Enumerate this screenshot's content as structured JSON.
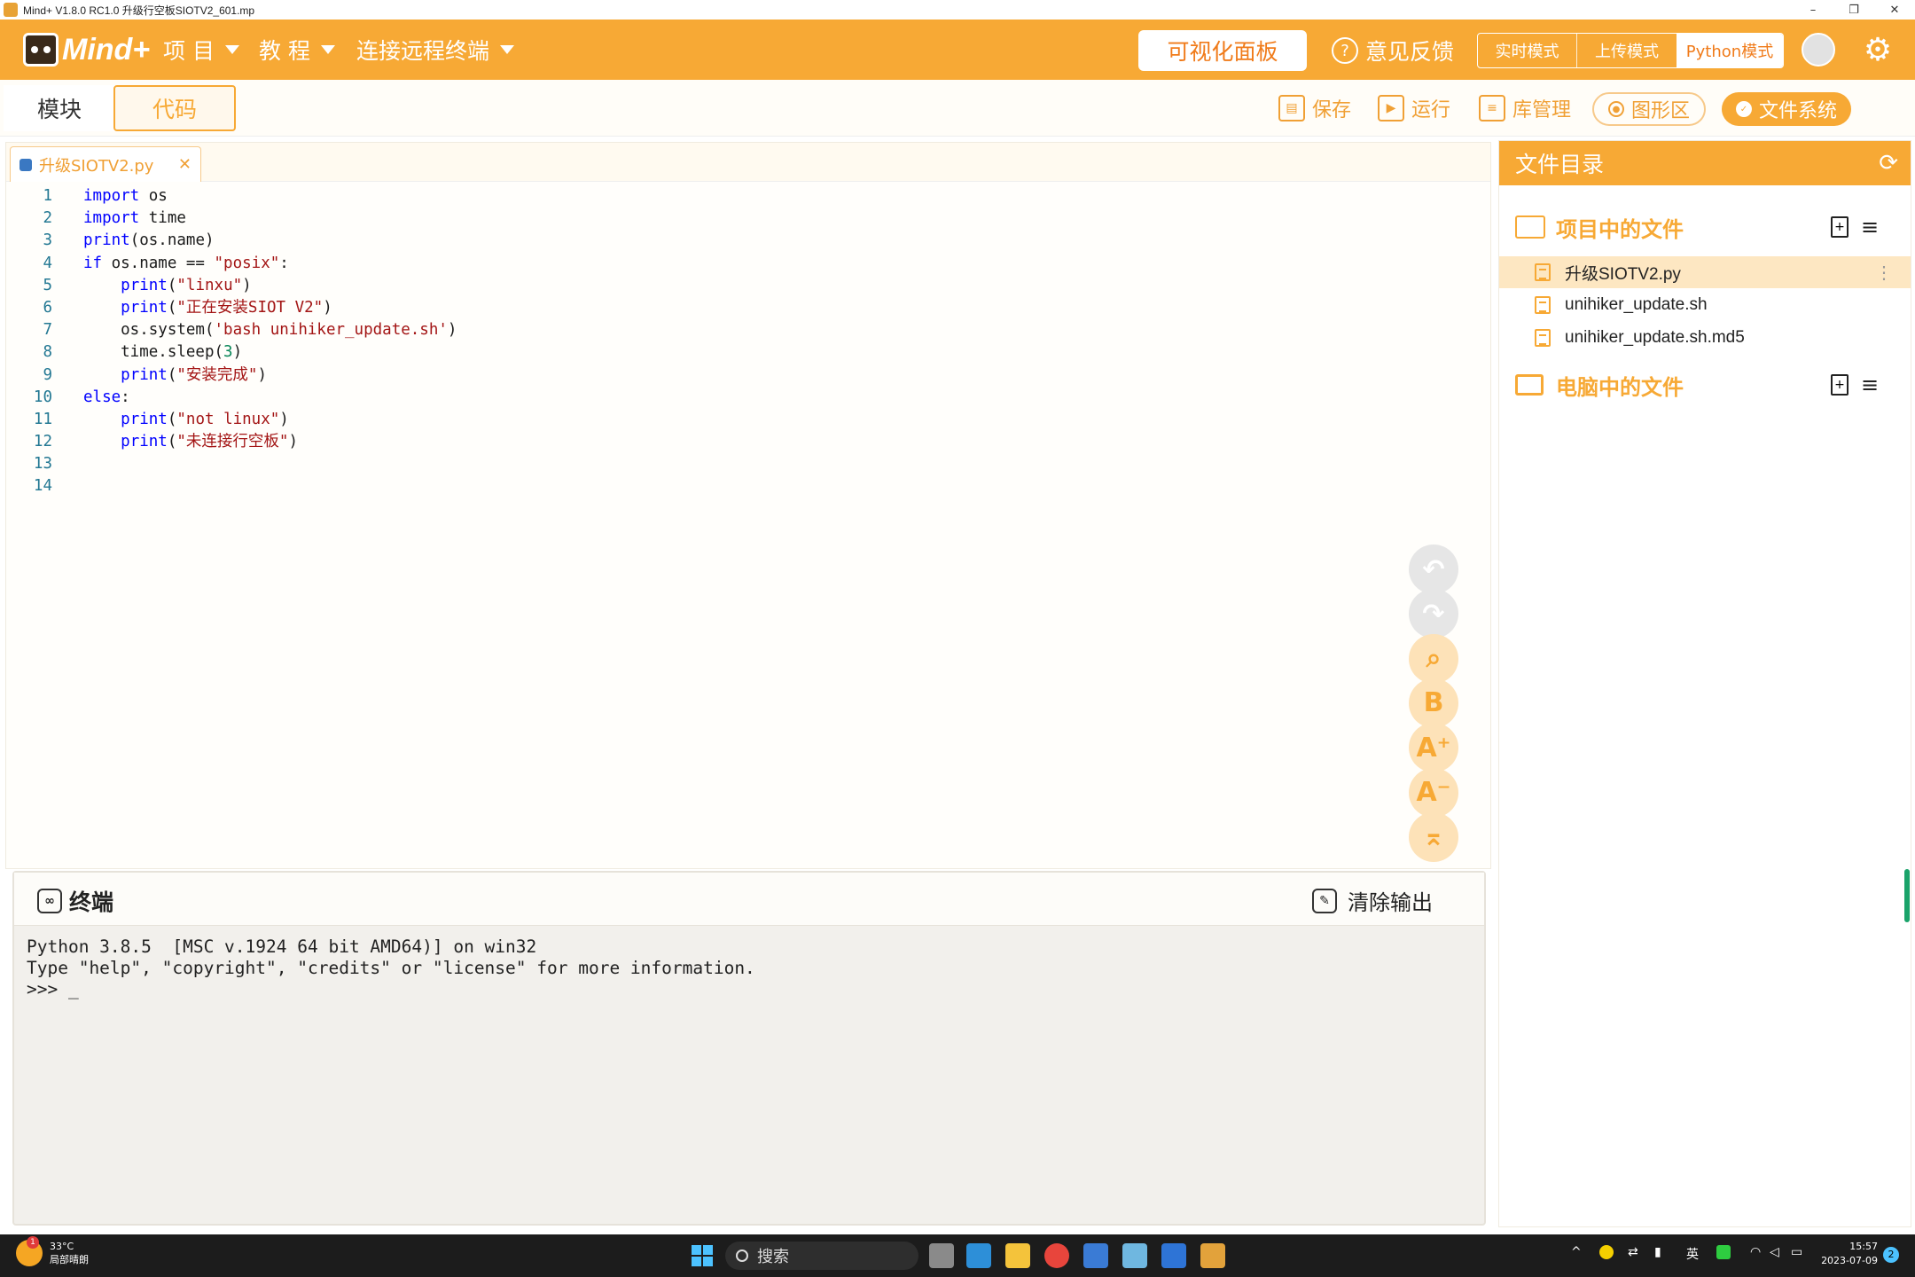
{
  "window": {
    "title": "Mind+ V1.8.0 RC1.0   升级行空板SIOTV2_601.mp",
    "minimize": "–",
    "maximize": "❐",
    "close": "✕"
  },
  "topbar": {
    "logo_text": "Mind+",
    "menu": [
      {
        "label": "项 目"
      },
      {
        "label": "教 程"
      },
      {
        "label": "连接远程终端"
      }
    ],
    "visual_panel": "可视化面板",
    "feedback": "意见反馈",
    "modes": [
      {
        "label": "实时模式",
        "active": false
      },
      {
        "label": "上传模式",
        "active": false
      },
      {
        "label": "Python模式",
        "active": true
      }
    ]
  },
  "toolbar": {
    "tab_blocks": "模块",
    "tab_code": "代码",
    "save": "保存",
    "run": "运行",
    "lib_manage": "库管理",
    "graphics": "图形区",
    "file_system": "文件系统"
  },
  "editor": {
    "open_tab": "升级SIOTV2.py",
    "close_tab": "✕",
    "lines": [
      {
        "n": "1",
        "code": "import os"
      },
      {
        "n": "2",
        "code": "import time"
      },
      {
        "n": "3",
        "code": "print(os.name)"
      },
      {
        "n": "4",
        "code": "if os.name == \"posix\":"
      },
      {
        "n": "5",
        "code": "    print(\"linxu\")"
      },
      {
        "n": "6",
        "code": "    print(\"正在安装SIOT V2\")"
      },
      {
        "n": "7",
        "code": "    os.system('bash unihiker_update.sh')"
      },
      {
        "n": "8",
        "code": "    time.sleep(3)"
      },
      {
        "n": "9",
        "code": "    print(\"安装完成\")"
      },
      {
        "n": "10",
        "code": "else:"
      },
      {
        "n": "11",
        "code": "    print(\"not linux\")"
      },
      {
        "n": "12",
        "code": "    print(\"未连接行空板\")"
      },
      {
        "n": "13",
        "code": ""
      },
      {
        "n": "14",
        "code": ""
      }
    ],
    "side_buttons": [
      {
        "name": "undo-button",
        "glyph": "↶",
        "style": "grey"
      },
      {
        "name": "redo-button",
        "glyph": "↷",
        "style": "grey"
      },
      {
        "name": "search-button",
        "glyph": "⌕",
        "style": "orange"
      },
      {
        "name": "format-button",
        "glyph": "B",
        "style": "orange"
      },
      {
        "name": "font-increase-button",
        "glyph": "A⁺",
        "style": "orange"
      },
      {
        "name": "font-decrease-button",
        "glyph": "A⁻",
        "style": "orange"
      },
      {
        "name": "scroll-top-button",
        "glyph": "⌅",
        "style": "orange"
      }
    ]
  },
  "terminal": {
    "title": "终端",
    "clear_output": "清除输出",
    "output": "Python 3.8.5  [MSC v.1924 64 bit AMD64)] on win32\nType \"help\", \"copyright\", \"credits\" or \"license\" for more information.\n>>> _"
  },
  "file_panel": {
    "title": "文件目录",
    "project_section": "项目中的文件",
    "project_files": [
      {
        "name": "升级SIOTV2.py",
        "selected": true
      },
      {
        "name": "unihiker_update.sh",
        "selected": false
      },
      {
        "name": "unihiker_update.sh.md5",
        "selected": false
      }
    ],
    "computer_section": "电脑中的文件"
  },
  "taskbar": {
    "weather_temp": "33°C",
    "weather_desc": "局部晴朗",
    "weather_badge": "1",
    "search": "搜索",
    "ime": "英",
    "time": "15:57",
    "date": "2023-07-09",
    "notifications": "2"
  },
  "colors": {
    "brand": "#f7a935",
    "accent_text": "#f07b1a"
  }
}
